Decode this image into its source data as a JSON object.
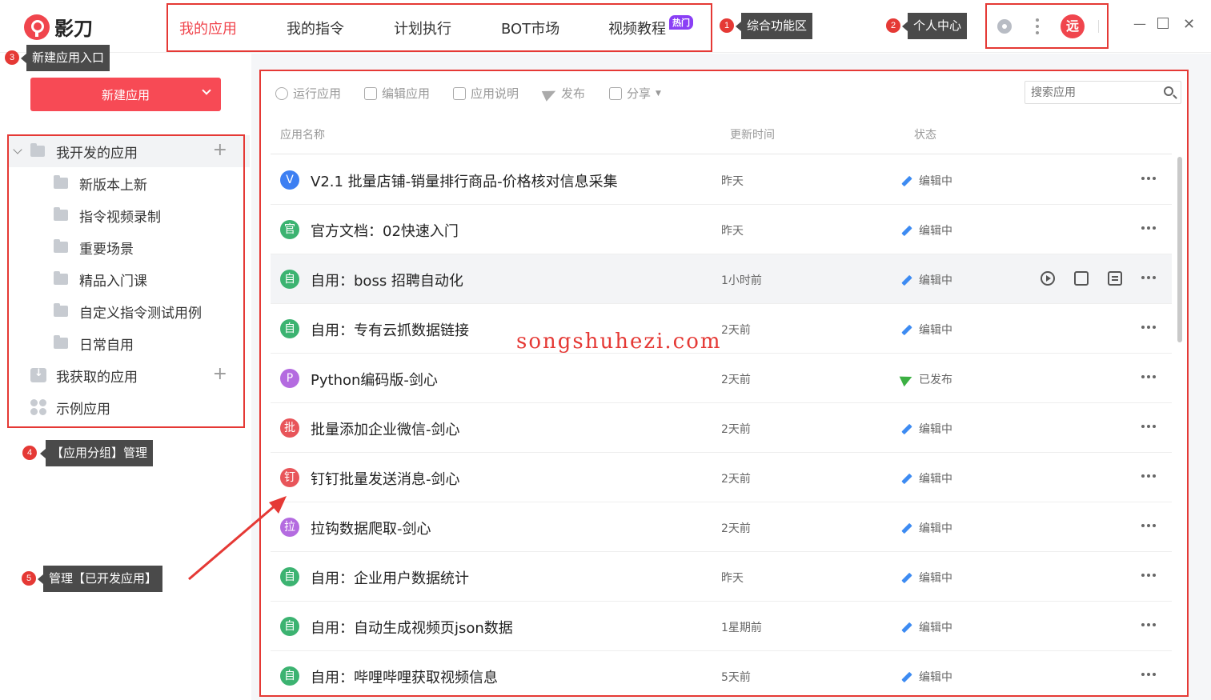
{
  "app": {
    "logo_text": "影刀"
  },
  "nav": {
    "items": [
      {
        "label": "我的应用"
      },
      {
        "label": "我的指令"
      },
      {
        "label": "计划执行"
      },
      {
        "label": "BOT市场"
      },
      {
        "label": "视频教程"
      }
    ],
    "hot_badge": "热门"
  },
  "user": {
    "avatar_text": "远"
  },
  "annotations": [
    {
      "num": "1",
      "label": "综合功能区"
    },
    {
      "num": "2",
      "label": "个人中心"
    },
    {
      "num": "3",
      "label": "新建应用入口"
    },
    {
      "num": "4",
      "label": "【应用分组】管理"
    },
    {
      "num": "5",
      "label": "管理【已开发应用】"
    }
  ],
  "sidebar": {
    "new_button": "新建应用",
    "my_dev": "我开发的应用",
    "groups": [
      "新版本上新",
      "指令视频录制",
      "重要场景",
      "精品入门课",
      "自定义指令测试用例",
      "日常自用"
    ],
    "acquired": "我获取的应用",
    "examples": "示例应用"
  },
  "toolbar": {
    "run": "运行应用",
    "edit": "编辑应用",
    "doc": "应用说明",
    "publish": "发布",
    "share": "分享",
    "search_placeholder": "搜索应用"
  },
  "table": {
    "headers": {
      "name": "应用名称",
      "time": "更新时间",
      "status": "状态"
    },
    "rows": [
      {
        "icon": "V",
        "color": "#3d7ff2",
        "name": "V2.1 批量店铺-销量排行商品-价格核对信息采集",
        "time": "昨天",
        "status": "编辑中"
      },
      {
        "icon": "官",
        "color": "#3cb371",
        "name": "官方文档：02快速入门",
        "time": "昨天",
        "status": "编辑中"
      },
      {
        "icon": "自",
        "color": "#3cb371",
        "name": "自用：boss 招聘自动化",
        "time": "1小时前",
        "status": "编辑中"
      },
      {
        "icon": "自",
        "color": "#3cb371",
        "name": "自用：专有云抓数据链接",
        "time": "2天前",
        "status": "编辑中"
      },
      {
        "icon": "P",
        "color": "#b46be0",
        "name": "Python编码版-剑心",
        "time": "2天前",
        "status": "已发布"
      },
      {
        "icon": "批",
        "color": "#e8555a",
        "name": "批量添加企业微信-剑心",
        "time": "2天前",
        "status": "编辑中"
      },
      {
        "icon": "钉",
        "color": "#e8555a",
        "name": "钉钉批量发送消息-剑心",
        "time": "2天前",
        "status": "编辑中"
      },
      {
        "icon": "拉",
        "color": "#b46be0",
        "name": "拉钩数据爬取-剑心",
        "time": "2天前",
        "status": "编辑中"
      },
      {
        "icon": "自",
        "color": "#3cb371",
        "name": "自用：企业用户数据统计",
        "time": "昨天",
        "status": "编辑中"
      },
      {
        "icon": "自",
        "color": "#3cb371",
        "name": "自用：自动生成视频页json数据",
        "time": "1星期前",
        "status": "编辑中"
      },
      {
        "icon": "自",
        "color": "#3cb371",
        "name": "自用：哔哩哔哩获取视频信息",
        "time": "5天前",
        "status": "编辑中"
      }
    ]
  },
  "watermark": "songshuhezi.com"
}
